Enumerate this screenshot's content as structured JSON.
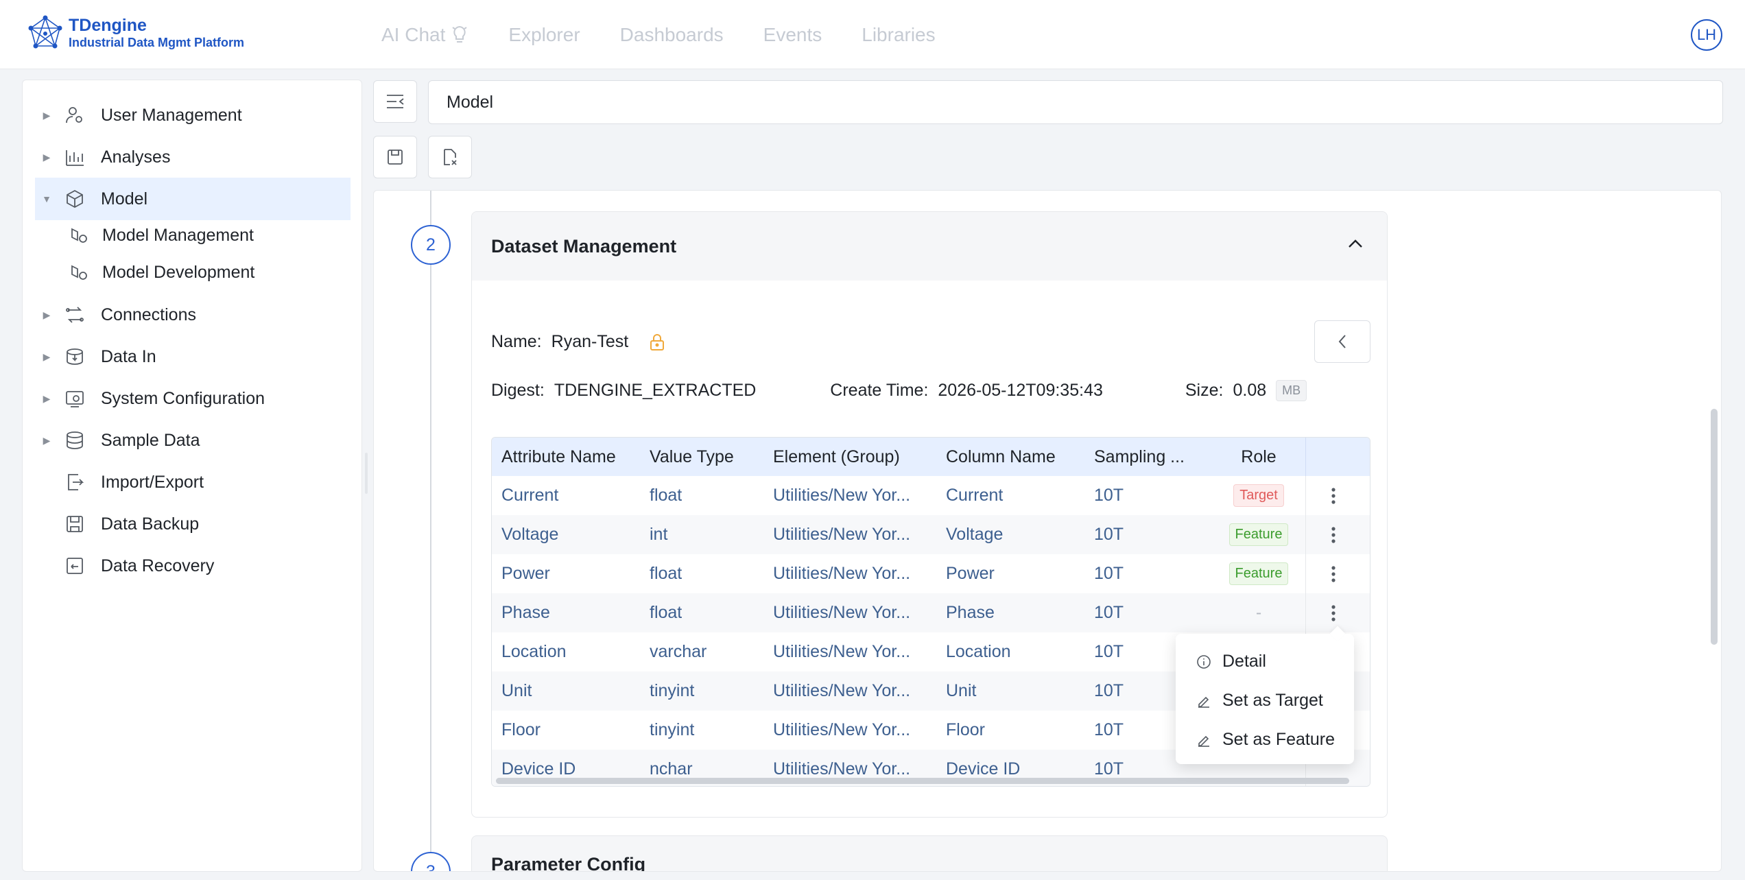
{
  "header": {
    "logo_title": "TDengine",
    "logo_subtitle": "Industrial Data Mgmt Platform",
    "nav": [
      {
        "label": "AI Chat",
        "icon": "lightbulb-icon"
      },
      {
        "label": "Explorer"
      },
      {
        "label": "Dashboards"
      },
      {
        "label": "Events"
      },
      {
        "label": "Libraries"
      }
    ],
    "avatar_initials": "LH"
  },
  "sidebar": {
    "items": [
      {
        "label": "User Management",
        "icon": "user-settings-icon",
        "expandable": true
      },
      {
        "label": "Analyses",
        "icon": "chart-icon",
        "expandable": true
      },
      {
        "label": "Model",
        "icon": "cube-icon",
        "expandable": true,
        "expanded": true,
        "active": true
      },
      {
        "label": "Model Management",
        "icon": "model-gear-icon",
        "sub": true
      },
      {
        "label": "Model Development",
        "icon": "model-gear-icon",
        "sub": true
      },
      {
        "label": "Connections",
        "icon": "connections-icon",
        "expandable": true
      },
      {
        "label": "Data In",
        "icon": "data-in-icon",
        "expandable": true
      },
      {
        "label": "System Configuration",
        "icon": "system-config-icon",
        "expandable": true
      },
      {
        "label": "Sample Data",
        "icon": "database-icon",
        "expandable": true
      },
      {
        "label": "Import/Export",
        "icon": "import-export-icon"
      },
      {
        "label": "Data Backup",
        "icon": "backup-icon"
      },
      {
        "label": "Data Recovery",
        "icon": "recovery-icon"
      }
    ]
  },
  "breadcrumb": {
    "title": "Model"
  },
  "steps": {
    "current_number": "2",
    "current_title": "Dataset Management",
    "next_number": "3",
    "next_title": "Parameter Config"
  },
  "dataset": {
    "name_label": "Name:",
    "name_value": "Ryan-Test",
    "digest_label": "Digest:",
    "digest_value": "TDENGINE_EXTRACTED",
    "create_time_label": "Create Time:",
    "create_time_value": "2026-05-12T09:35:43",
    "size_label": "Size:",
    "size_value": "0.08",
    "size_unit": "MB"
  },
  "table": {
    "headers": [
      "Attribute Name",
      "Value Type",
      "Element (Group)",
      "Column Name",
      "Sampling ...",
      "Role"
    ],
    "rows": [
      {
        "attr": "Current",
        "type": "float",
        "element": "Utilities/New Yor...",
        "column": "Current",
        "sampling": "10T",
        "role": "Target"
      },
      {
        "attr": "Voltage",
        "type": "int",
        "element": "Utilities/New Yor...",
        "column": "Voltage",
        "sampling": "10T",
        "role": "Feature"
      },
      {
        "attr": "Power",
        "type": "float",
        "element": "Utilities/New Yor...",
        "column": "Power",
        "sampling": "10T",
        "role": "Feature"
      },
      {
        "attr": "Phase",
        "type": "float",
        "element": "Utilities/New Yor...",
        "column": "Phase",
        "sampling": "10T",
        "role": "-"
      },
      {
        "attr": "Location",
        "type": "varchar",
        "element": "Utilities/New Yor...",
        "column": "Location",
        "sampling": "10T",
        "role": ""
      },
      {
        "attr": "Unit",
        "type": "tinyint",
        "element": "Utilities/New Yor...",
        "column": "Unit",
        "sampling": "10T",
        "role": ""
      },
      {
        "attr": "Floor",
        "type": "tinyint",
        "element": "Utilities/New Yor...",
        "column": "Floor",
        "sampling": "10T",
        "role": ""
      },
      {
        "attr": "Device ID",
        "type": "nchar",
        "element": "Utilities/New Yor...",
        "column": "Device ID",
        "sampling": "10T",
        "role": ""
      }
    ]
  },
  "row_menu": {
    "items": [
      {
        "label": "Detail",
        "icon": "info-icon"
      },
      {
        "label": "Set as Target",
        "icon": "edit-icon"
      },
      {
        "label": "Set as Feature",
        "icon": "edit-icon"
      }
    ]
  },
  "colors": {
    "brand": "#1f56c4",
    "accent": "#2d62d3",
    "active_bg": "#e8f1ff",
    "target_tag": "#e05a5a",
    "feature_tag": "#3b9c2d",
    "lock_icon": "#f0a93b"
  }
}
